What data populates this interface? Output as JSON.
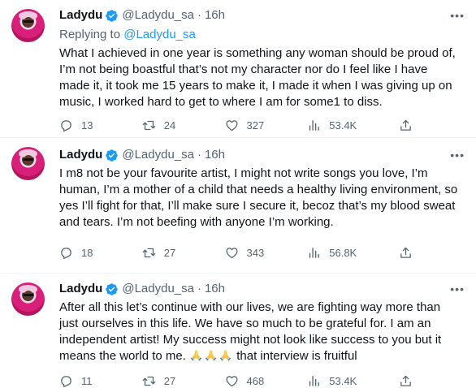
{
  "tweets": [
    {
      "name": "Ladydu",
      "handle": "@Ladydu_sa",
      "dot": "·",
      "time": "16h",
      "replying_prefix": "Replying to ",
      "replying_to": "@Ladydu_sa",
      "text": "What I achieved in one year is something any woman should be proud of,\nI’m not being boastful that’s not my character nor do I feel like I have\nmade it, it took me 15 years to make it, I made it when I was giving up on\nmusic, I worked hard to get to where I am for some1 to diss.",
      "replies": "13",
      "retweets": "24",
      "likes": "327",
      "views": "53.4K"
    },
    {
      "name": "Ladydu",
      "handle": "@Ladydu_sa",
      "dot": "·",
      "time": "16h",
      "text": "I m8 not be your favourite artist, I might not write songs you love, I’m\nhuman, I’m a mother of a child that needs a healthy living environment, so\nyes I’ll fight for that, I’ll make sure I secure it, becoz that’s my blood sweat\nand tears. I’m not beefing with anyone I’m working.",
      "replies": "18",
      "retweets": "27",
      "likes": "343",
      "views": "56.8K"
    },
    {
      "name": "Ladydu",
      "handle": "@Ladydu_sa",
      "dot": "·",
      "time": "16h",
      "text": "After all this let’s continue with our lives, we are fighting way more than\njust ourselves in this life. We have so much to be grateful for. I am an\nindependent artist! My success might not look like success to you but it\nmeans the world to me. ",
      "text_tail": " that interview is fruitful",
      "emoji": "folded-hands-emoji ×3",
      "replies": "11",
      "retweets": "27",
      "likes": "468",
      "views": "53.4K"
    }
  ],
  "icons": {
    "verified": "verified-badge-icon",
    "more": "more-options-icon",
    "reply": "reply-icon",
    "retweet": "retweet-icon",
    "like": "like-icon",
    "views": "views-icon",
    "share": "share-icon"
  },
  "colors": {
    "text": "#0f1419",
    "secondary": "#536471",
    "accent": "#1d9bf0",
    "divider": "#eff3f4"
  }
}
